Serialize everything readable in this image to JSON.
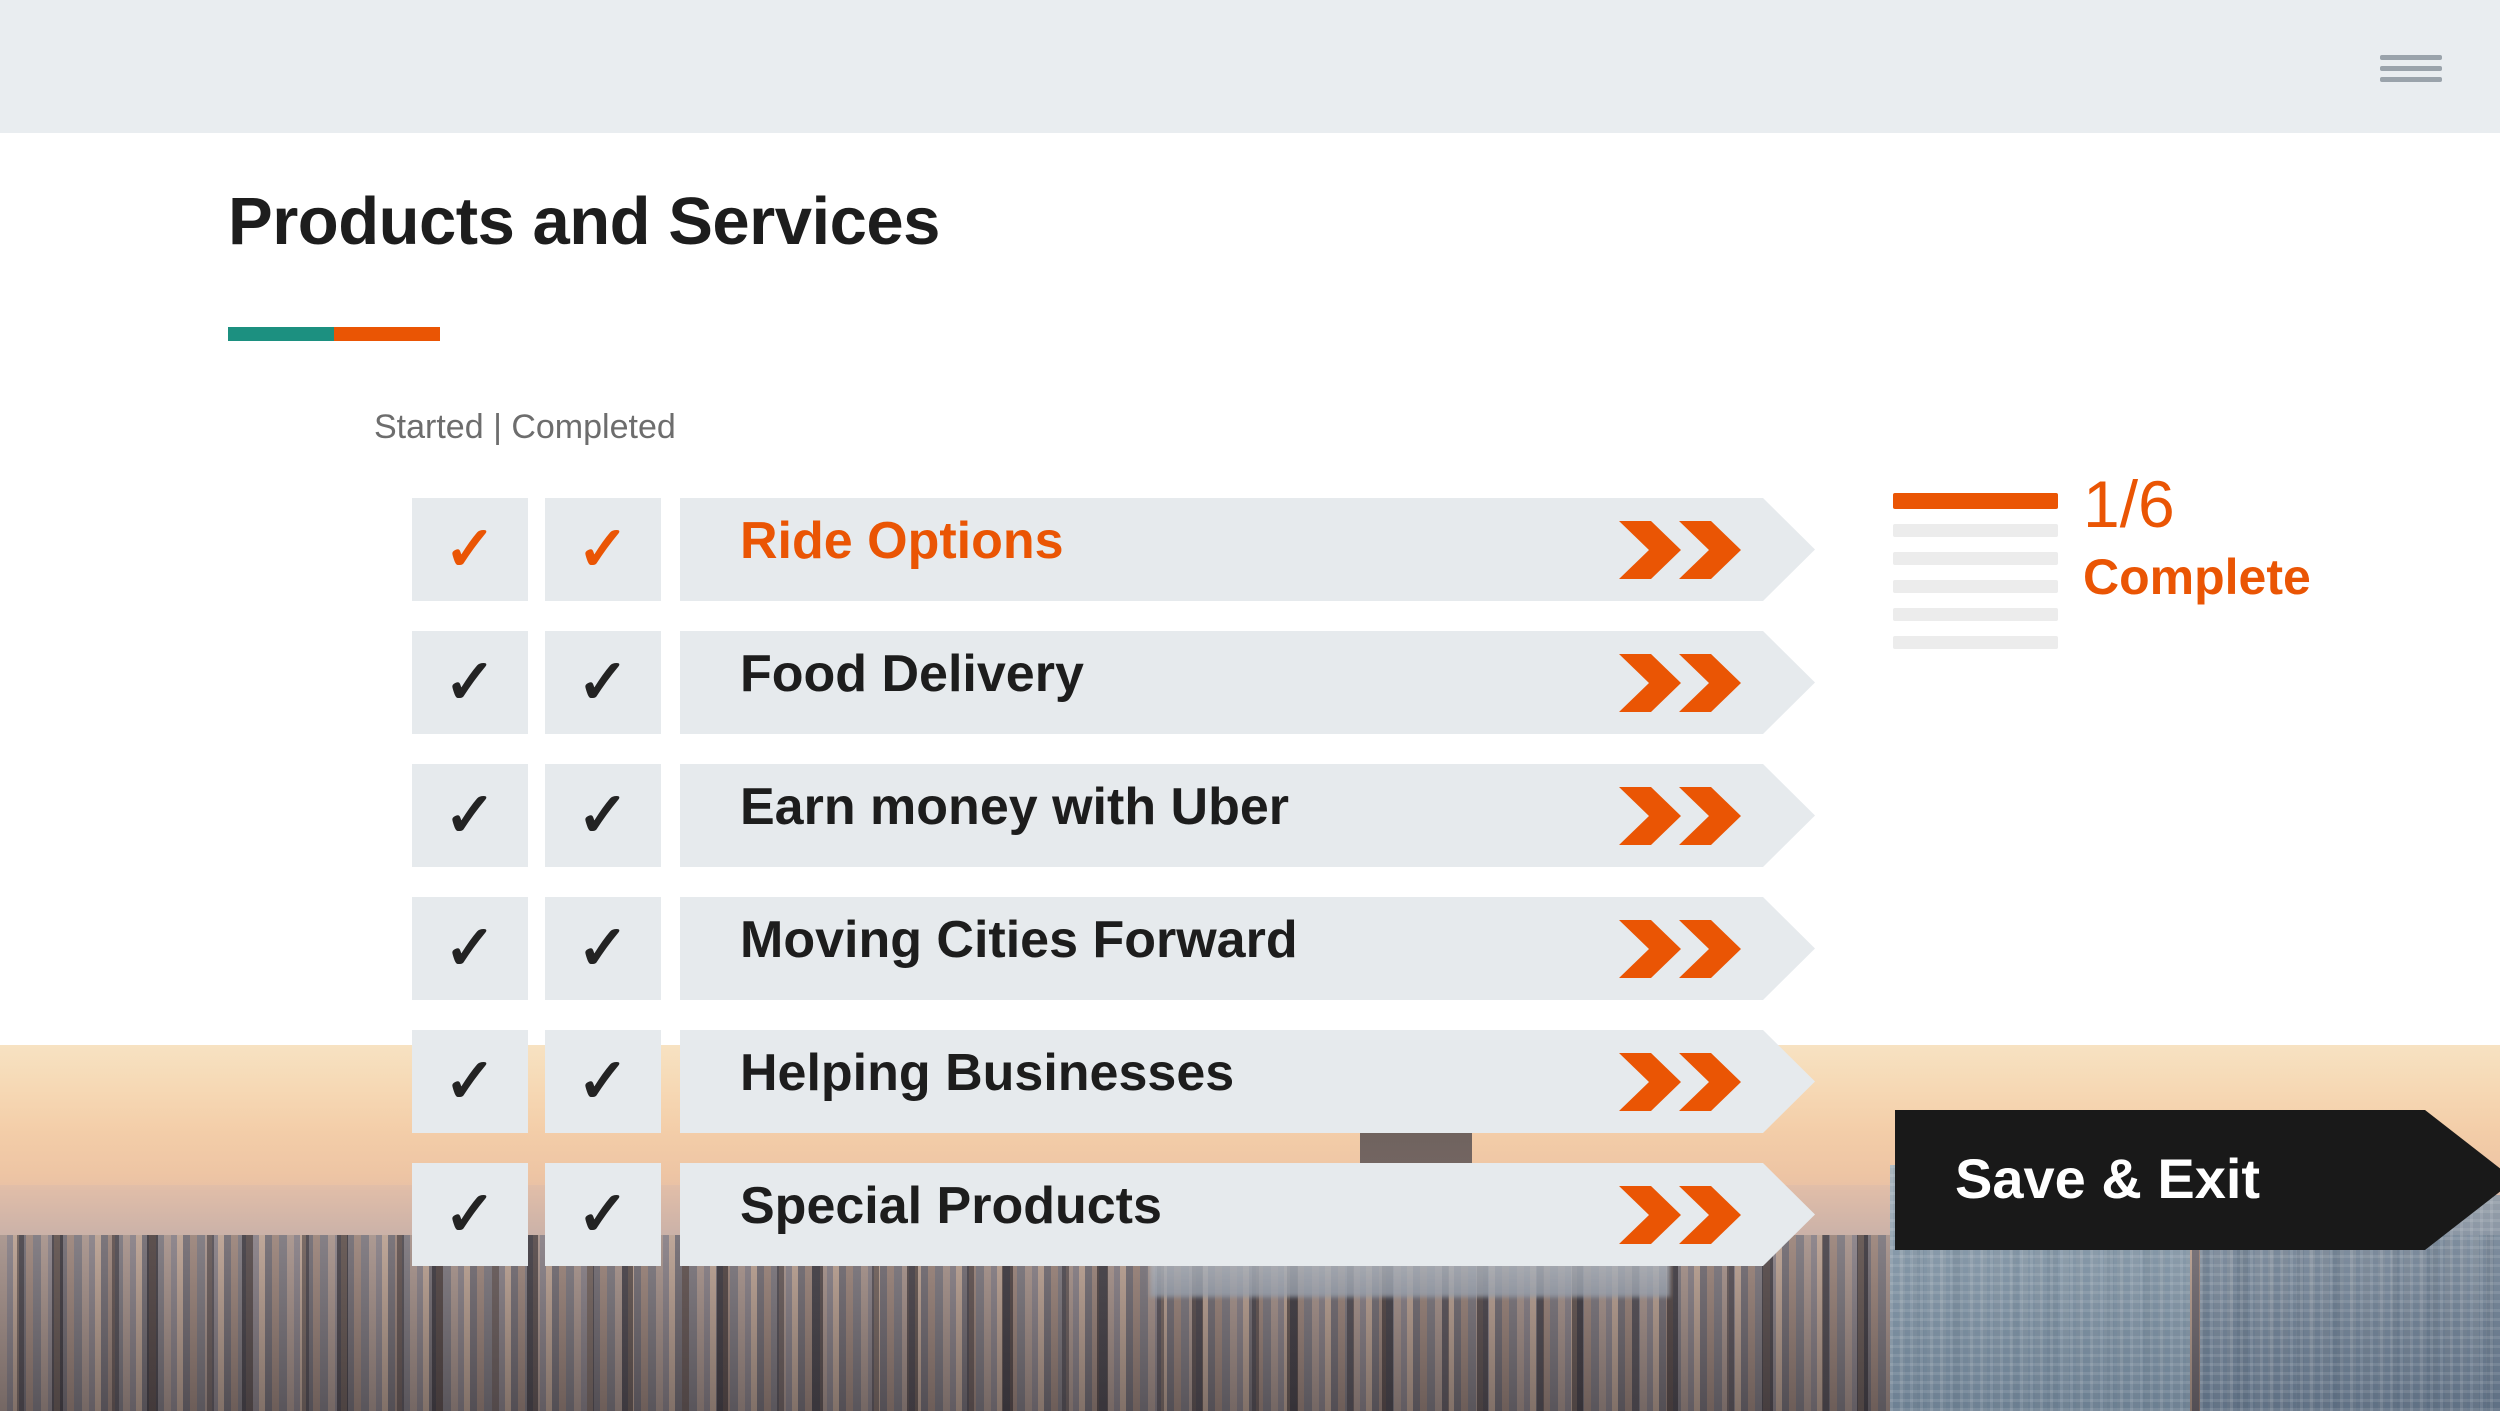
{
  "header": {
    "menu_icon": "hamburger-menu-icon"
  },
  "page": {
    "title": "Products and Services",
    "legend": "Started | Completed",
    "accent_teal": "#1C9080",
    "accent_orange": "#EA5504"
  },
  "checklist": {
    "columns": [
      "Started",
      "Completed"
    ],
    "check_glyph": "✓",
    "items": [
      {
        "label": "Ride Options",
        "started": true,
        "completed": true,
        "active": true
      },
      {
        "label": "Food Delivery",
        "started": true,
        "completed": true,
        "active": false
      },
      {
        "label": "Earn money with Uber",
        "started": true,
        "completed": true,
        "active": false
      },
      {
        "label": "Moving Cities Forward",
        "started": true,
        "completed": true,
        "active": false
      },
      {
        "label": "Helping Businesses",
        "started": true,
        "completed": true,
        "active": false
      },
      {
        "label": "Special Products",
        "started": true,
        "completed": true,
        "active": false
      }
    ]
  },
  "progress": {
    "count": "1/6",
    "word": "Complete",
    "total_bars": 6,
    "filled_bars": 1,
    "color": "#EA5504"
  },
  "actions": {
    "save_exit": "Save & Exit"
  }
}
